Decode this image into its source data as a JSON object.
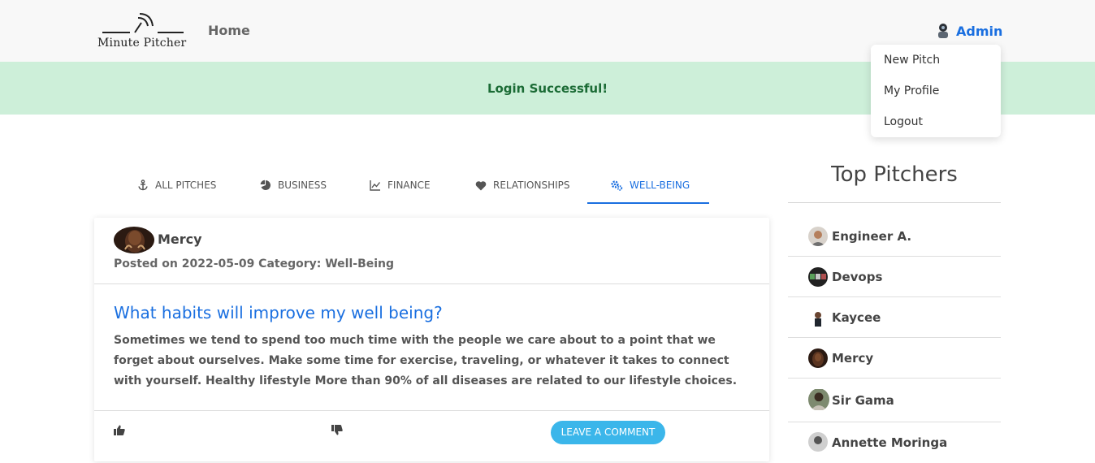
{
  "navbar": {
    "logo_text": "Minute Pitcher",
    "home_label": "Home",
    "user_name": "Admin",
    "dropdown": [
      "New Pitch",
      "My Profile",
      "Logout"
    ]
  },
  "alert": {
    "message": "Login Successful!"
  },
  "tabs": [
    {
      "label": "ALL PITCHES",
      "icon": "anchor-icon",
      "active": false
    },
    {
      "label": "BUSINESS",
      "icon": "pie-chart-icon",
      "active": false
    },
    {
      "label": "FINANCE",
      "icon": "line-chart-icon",
      "active": false
    },
    {
      "label": "RELATIONSHIPS",
      "icon": "heart-icon",
      "active": false
    },
    {
      "label": "WELL-BEING",
      "icon": "gears-icon",
      "active": true
    }
  ],
  "pitch": {
    "author": "Mercy",
    "posted": "Posted on 2022-05-09 Category: Well-Being",
    "title": "What habits will improve my well being?",
    "body": "Sometimes we tend to spend too much time with the people we care about to a point that we forget about ourselves. Make some time for exercise, traveling, or whatever it takes to connect with yourself. Healthy lifestyle More than 90% of all diseases are related to our lifestyle choices.",
    "comment_label": "LEAVE A COMMENT"
  },
  "top_pitchers": {
    "title": "Top Pitchers",
    "items": [
      "Engineer A.",
      "Devops",
      "Kaycee",
      "Mercy",
      "Sir Gama",
      "Annette Moringa"
    ]
  },
  "colors": {
    "accent": "#1a6fe0",
    "alert_bg": "#cdefd9",
    "alert_text": "#1b6b35",
    "comment_btn": "#3bb6ea"
  }
}
